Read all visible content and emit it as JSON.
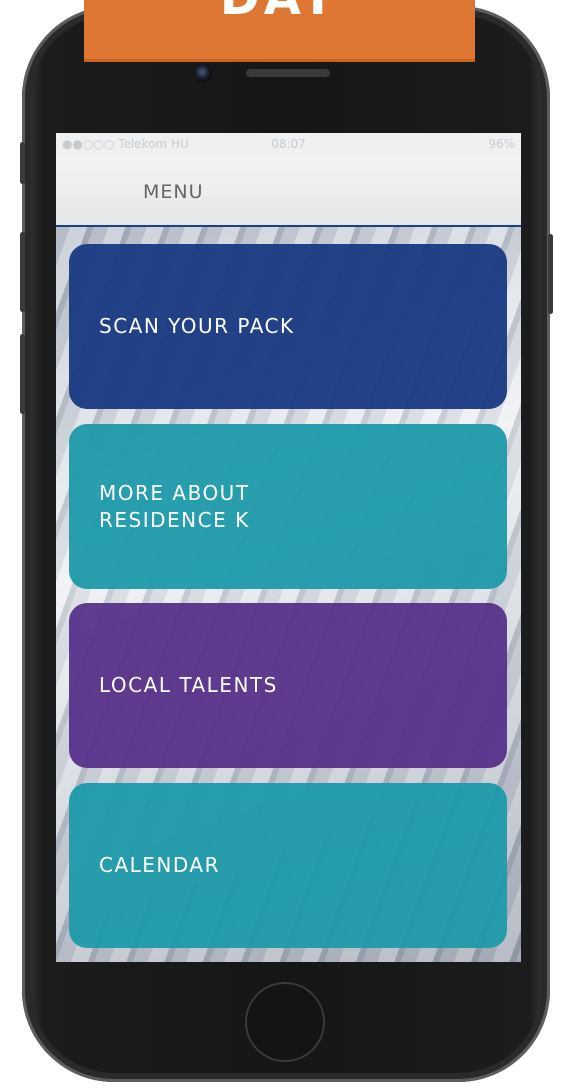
{
  "banner": {
    "text": "DAY"
  },
  "statusbar": {
    "carrier": "●●○○○ Telekom HU",
    "time": "08:07",
    "battery": "96%"
  },
  "navbar": {
    "title": "MENU"
  },
  "menu": {
    "items": [
      {
        "label": "SCAN YOUR PACK",
        "color": "#1b3a82"
      },
      {
        "label": "MORE ABOUT\nRESIDENCE K",
        "color": "#1e9aaa"
      },
      {
        "label": "LOCAL TALENTS",
        "color": "#563289"
      },
      {
        "label": "CALENDAR",
        "color": "#1e9aaa"
      }
    ]
  }
}
